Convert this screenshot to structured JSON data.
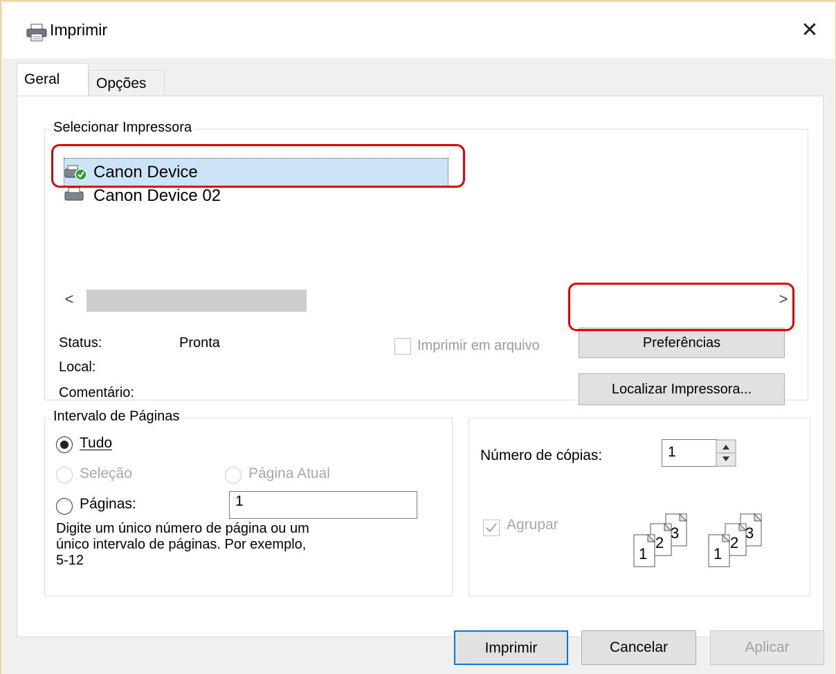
{
  "window": {
    "title": "Imprimir",
    "close_glyph": "✕",
    "icon": "printer-icon"
  },
  "tabs": [
    {
      "label": "Geral"
    },
    {
      "label": "Opções"
    }
  ],
  "printer_group": {
    "title": "Selecionar Impressora",
    "printers": [
      {
        "name": "Canon Device",
        "icon": "printer-default-icon",
        "selected": true
      },
      {
        "name": "Canon Device 02",
        "icon": "printer-icon",
        "selected": false
      }
    ],
    "scroll_left": "<",
    "scroll_right": ">",
    "status_label": "Status:",
    "status_value": "Pronta",
    "location_label": "Local:",
    "comment_label": "Comentário:",
    "print_to_file_label": "Imprimir em arquivo",
    "preferences_button": "Preferências",
    "find_printer_button": "Localizar Impressora..."
  },
  "page_range": {
    "title": "Intervalo de Páginas",
    "all_label": "Tudo",
    "selection_label": "Seleção",
    "current_page_label": "Página Atual",
    "pages_label": "Páginas:",
    "pages_value": "1",
    "hint": "Digite um único número de página ou um único intervalo de páginas. Por exemplo, 5-12",
    "hint_lines": [
      "Digite um único número de página ou um",
      "único intervalo de páginas. Por exemplo,",
      "5-12"
    ]
  },
  "copies": {
    "count_label": "Número de cópias:",
    "count_value": "1",
    "collate_label": "Agrupar",
    "collate_checked": true,
    "collate_pages": [
      "1",
      "2",
      "3"
    ]
  },
  "footer": {
    "print_button": "Imprimir",
    "cancel_button": "Cancelar",
    "apply_button": "Aplicar"
  },
  "colors": {
    "highlight": "#e00000",
    "selection": "#cce4f7",
    "accent": "#0078d7"
  }
}
